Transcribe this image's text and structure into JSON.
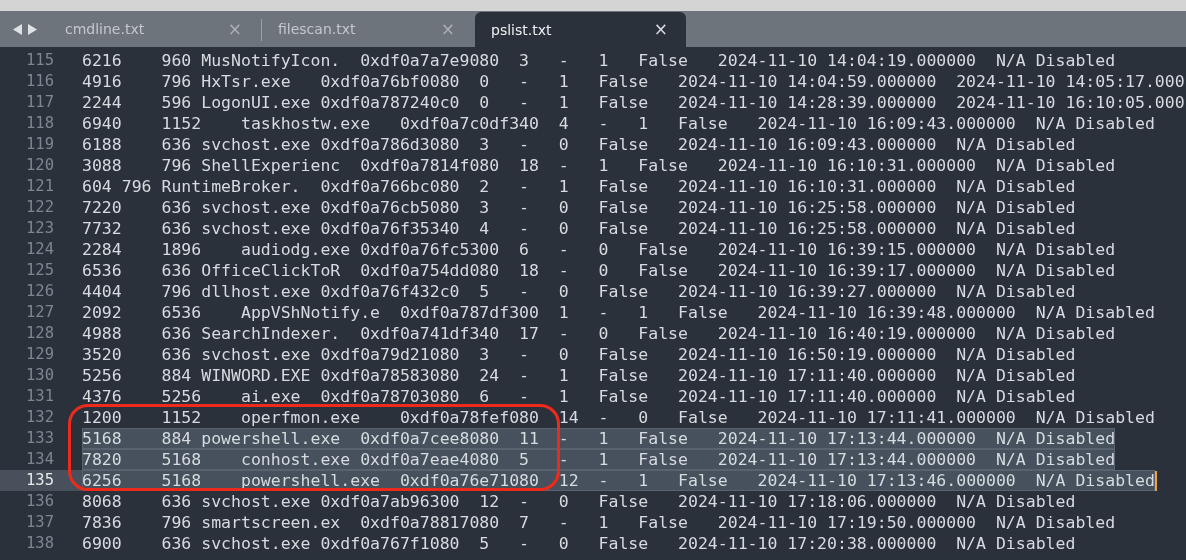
{
  "tabs": [
    {
      "label": "cmdline.txt",
      "close": "×",
      "selected": false
    },
    {
      "label": "filescan.txt",
      "close": "×",
      "selected": false
    },
    {
      "label": "pslist.txt",
      "close": "×",
      "selected": true
    }
  ],
  "editor": {
    "lines": [
      {
        "number": "115",
        "text": "6216\t960\tMusNotifyIcon.\t0xdf0a7a7e9080\t3\t-\t1\tFalse\t2024-11-10 14:04:19.000000\tN/A\tDisabled",
        "selected": false,
        "current": false
      },
      {
        "number": "116",
        "text": "4916\t796\tHxTsr.exe\t0xdf0a76bf0080\t0\t-\t1\tFalse\t2024-11-10 14:04:59.000000\t2024-11-10 14:05:17.000",
        "selected": false,
        "current": false
      },
      {
        "number": "117",
        "text": "2244\t596\tLogonUI.exe\t0xdf0a787240c0\t0\t-\t1\tFalse\t2024-11-10 14:28:39.000000\t2024-11-10 16:10:05.000",
        "selected": false,
        "current": false
      },
      {
        "number": "118",
        "text": "6940\t1152\ttaskhostw.exe\t0xdf0a7c0df340\t4\t-\t1\tFalse\t2024-11-10 16:09:43.000000\tN/A\tDisabled",
        "selected": false,
        "current": false
      },
      {
        "number": "119",
        "text": "6188\t636\tsvchost.exe\t0xdf0a786d3080\t3\t-\t0\tFalse\t2024-11-10 16:09:43.000000\tN/A\tDisabled",
        "selected": false,
        "current": false
      },
      {
        "number": "120",
        "text": "3088\t796\tShellExperienc\t0xdf0a7814f080\t18\t-\t1\tFalse\t2024-11-10 16:10:31.000000\tN/A\tDisabled",
        "selected": false,
        "current": false
      },
      {
        "number": "121",
        "text": "604\t796\tRuntimeBroker.\t0xdf0a766bc080\t2\t-\t1\tFalse\t2024-11-10 16:10:31.000000\tN/A\tDisabled",
        "selected": false,
        "current": false
      },
      {
        "number": "122",
        "text": "7220\t636\tsvchost.exe\t0xdf0a76cb5080\t3\t-\t0\tFalse\t2024-11-10 16:25:58.000000\tN/A\tDisabled",
        "selected": false,
        "current": false
      },
      {
        "number": "123",
        "text": "7732\t636\tsvchost.exe\t0xdf0a76f35340\t4\t-\t0\tFalse\t2024-11-10 16:25:58.000000\tN/A\tDisabled",
        "selected": false,
        "current": false
      },
      {
        "number": "124",
        "text": "2284\t1896\taudiodg.exe\t0xdf0a76fc5300\t6\t-\t0\tFalse\t2024-11-10 16:39:15.000000\tN/A\tDisabled",
        "selected": false,
        "current": false
      },
      {
        "number": "125",
        "text": "6536\t636\tOfficeClickToR\t0xdf0a754dd080\t18\t-\t0\tFalse\t2024-11-10 16:39:17.000000\tN/A\tDisabled",
        "selected": false,
        "current": false
      },
      {
        "number": "126",
        "text": "4404\t796\tdllhost.exe\t0xdf0a76f432c0\t5\t-\t0\tFalse\t2024-11-10 16:39:27.000000\tN/A\tDisabled",
        "selected": false,
        "current": false
      },
      {
        "number": "127",
        "text": "2092\t6536\tAppVShNotify.e\t0xdf0a787df300\t1\t-\t1\tFalse\t2024-11-10 16:39:48.000000\tN/A\tDisabled",
        "selected": false,
        "current": false
      },
      {
        "number": "128",
        "text": "4988\t636\tSearchIndexer.\t0xdf0a741df340\t17\t-\t0\tFalse\t2024-11-10 16:40:19.000000\tN/A\tDisabled",
        "selected": false,
        "current": false
      },
      {
        "number": "129",
        "text": "3520\t636\tsvchost.exe\t0xdf0a79d21080\t3\t-\t0\tFalse\t2024-11-10 16:50:19.000000\tN/A\tDisabled",
        "selected": false,
        "current": false
      },
      {
        "number": "130",
        "text": "5256\t884\tWINWORD.EXE\t0xdf0a78583080\t24\t-\t1\tFalse\t2024-11-10 17:11:40.000000\tN/A\tDisabled",
        "selected": false,
        "current": false
      },
      {
        "number": "131",
        "text": "4376\t5256\tai.exe\t0xdf0a78703080\t6\t-\t1\tFalse\t2024-11-10 17:11:40.000000\tN/A\tDisabled",
        "selected": false,
        "current": false
      },
      {
        "number": "132",
        "text": "1200\t1152\toperfmon.exe\t0xdf0a78fef080\t14\t-\t0\tFalse\t2024-11-10 17:11:41.000000\tN/A\tDisabled",
        "selected": false,
        "current": false
      },
      {
        "number": "133",
        "text": "5168\t884\tpowershell.exe\t0xdf0a7cee8080\t11\t-\t1\tFalse\t2024-11-10 17:13:44.000000\tN/A\tDisabled",
        "selected": true,
        "current": false
      },
      {
        "number": "134",
        "text": "7820\t5168\tconhost.exe\t0xdf0a7eae4080\t5\t-\t1\tFalse\t2024-11-10 17:13:44.000000\tN/A\tDisabled",
        "selected": true,
        "current": false
      },
      {
        "number": "135",
        "text": "6256\t5168\tpowershell.exe\t0xdf0a76e71080\t12\t-\t1\tFalse\t2024-11-10 17:13:46.000000\tN/A\tDisabled",
        "selected": true,
        "current": true
      },
      {
        "number": "136",
        "text": "8068\t636\tsvchost.exe\t0xdf0a7ab96300\t12\t-\t0\tFalse\t2024-11-10 17:18:06.000000\tN/A\tDisabled",
        "selected": false,
        "current": false
      },
      {
        "number": "137",
        "text": "7836\t796\tsmartscreen.ex\t0xdf0a78817080\t7\t-\t1\tFalse\t2024-11-10 17:19:50.000000\tN/A\tDisabled",
        "selected": false,
        "current": false
      },
      {
        "number": "138",
        "text": "6900\t636\tsvchost.exe\t0xdf0a767f1080\t5\t-\t0\tFalse\t2024-11-10 17:20:38.000000\tN/A\tDisabled",
        "selected": false,
        "current": false
      }
    ]
  },
  "annotations": [
    {
      "kind": "rounded-rectangle"
    }
  ]
}
